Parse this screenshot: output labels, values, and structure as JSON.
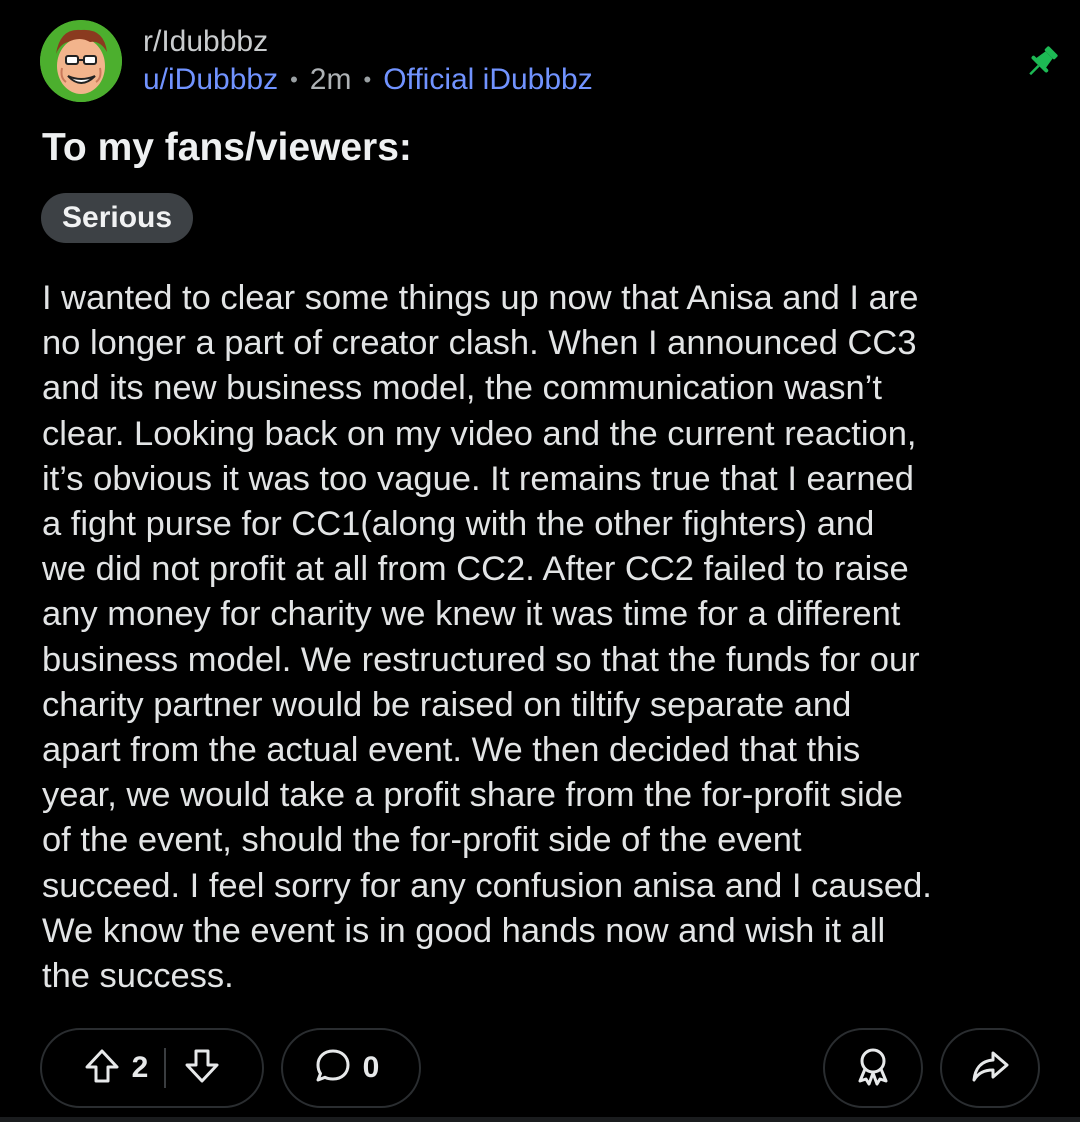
{
  "header": {
    "subreddit": "r/Idubbbz",
    "username": "u/iDubbbz",
    "time": "2m",
    "user_flair": "Official iDubbbz",
    "separator": "•"
  },
  "post": {
    "title": "To my fans/viewers:",
    "flair": "Serious",
    "body": "I wanted to clear some things up now that Anisa and I are\nno longer a part of creator clash.  When I announced CC3\nand its new business model, the communication wasn’t\nclear. Looking back on my video and the current reaction,\nit’s obvious it was too vague. It remains true that I earned\na fight purse for CC1(along with the other fighters) and\nwe did not profit at all from CC2. After CC2 failed to raise\nany money for charity we knew it was time for a different\nbusiness model. We restructured so that the funds for our\ncharity partner would be raised on tiltify separate and\napart from the actual event. We then decided that this\nyear, we would take a profit share from the for-profit side\nof the event, should the for-profit side of the event\nsucceed. I feel sorry for any confusion anisa and I caused.\nWe know the event is in good hands now and wish it all\nthe success."
  },
  "actions": {
    "upvotes": "2",
    "comments": "0"
  },
  "icons": {
    "avatar": "cartoon-face-avatar",
    "pin": "pin-icon",
    "upvote": "upvote-arrow-icon",
    "downvote": "downvote-arrow-icon",
    "comment": "comment-bubble-icon",
    "award": "award-icon",
    "share": "share-icon"
  },
  "colors": {
    "background": "#000000",
    "link": "#7193ff",
    "pin": "#1db954",
    "flair_bg": "#3d4145"
  }
}
